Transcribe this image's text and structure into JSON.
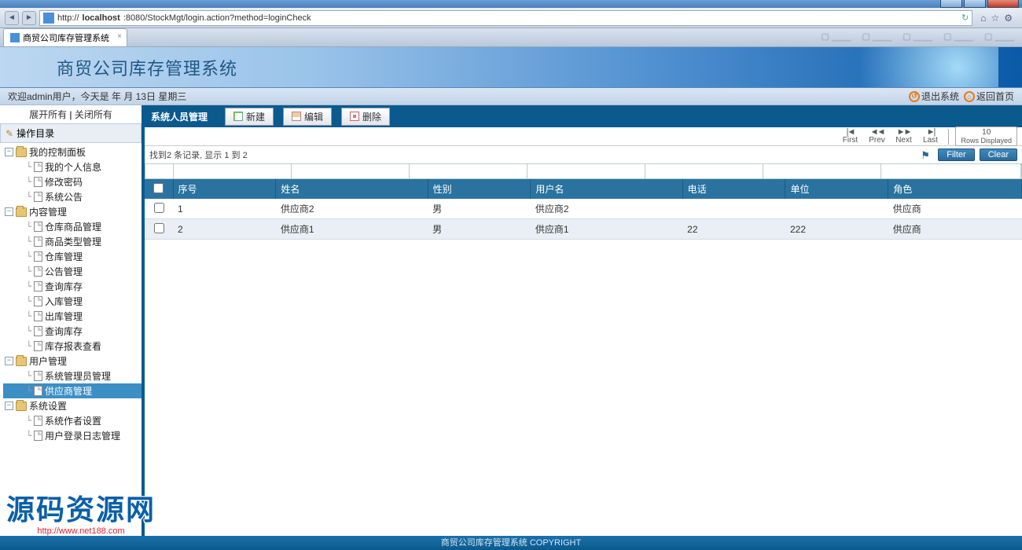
{
  "browser": {
    "url_prefix": "http://",
    "url_host": "localhost",
    "url_port_path": ":8080/StockMgt/login.action?method=loginCheck",
    "tab_title": "商贸公司库存管理系统"
  },
  "banner": {
    "title": "商贸公司库存管理系统"
  },
  "welcome": {
    "text": "欢迎admin用户，今天是 年 月 13日 星期三",
    "logout": "退出系统",
    "home": "返回首页"
  },
  "sidebar": {
    "expand_all": "展开所有",
    "collapse_all": "关闭所有",
    "ops": "操作目录",
    "nodes": [
      {
        "lvl": 1,
        "type": "folder",
        "open": true,
        "label": "我的控制面板"
      },
      {
        "lvl": 2,
        "type": "doc",
        "label": "我的个人信息"
      },
      {
        "lvl": 2,
        "type": "doc",
        "label": "修改密码"
      },
      {
        "lvl": 2,
        "type": "doc",
        "label": "系统公告"
      },
      {
        "lvl": 1,
        "type": "folder",
        "open": true,
        "label": "内容管理"
      },
      {
        "lvl": 2,
        "type": "doc",
        "label": "仓库商品管理"
      },
      {
        "lvl": 2,
        "type": "doc",
        "label": "商品类型管理"
      },
      {
        "lvl": 2,
        "type": "doc",
        "label": "仓库管理"
      },
      {
        "lvl": 2,
        "type": "doc",
        "label": "公告管理"
      },
      {
        "lvl": 2,
        "type": "doc",
        "label": "查询库存"
      },
      {
        "lvl": 2,
        "type": "doc",
        "label": "入库管理"
      },
      {
        "lvl": 2,
        "type": "doc",
        "label": "出库管理"
      },
      {
        "lvl": 2,
        "type": "doc",
        "label": "查询库存"
      },
      {
        "lvl": 2,
        "type": "doc",
        "label": "库存报表查看"
      },
      {
        "lvl": 1,
        "type": "folder",
        "open": true,
        "label": "用户管理"
      },
      {
        "lvl": 2,
        "type": "doc",
        "label": "系统管理员管理"
      },
      {
        "lvl": 2,
        "type": "doc",
        "label": "供应商管理",
        "selected": true
      },
      {
        "lvl": 1,
        "type": "folder",
        "open": true,
        "label": "系统设置"
      },
      {
        "lvl": 2,
        "type": "doc",
        "label": "系统作者设置"
      },
      {
        "lvl": 2,
        "type": "doc",
        "label": "用户登录日志管理"
      }
    ]
  },
  "panel": {
    "title": "系统人员管理",
    "btn_new": "新建",
    "btn_edit": "编辑",
    "btn_delete": "删除"
  },
  "pager": {
    "first": "First",
    "prev": "Prev",
    "next": "Next",
    "last": "Last",
    "rows_value": "10",
    "rows_label": "Rows Displayed"
  },
  "info": {
    "summary": "找到2 条记录, 显示 1 到 2",
    "filter": "Filter",
    "clear": "Clear"
  },
  "table": {
    "columns": [
      "",
      "序号",
      "姓名",
      "性别",
      "用户名",
      "电话",
      "单位",
      "角色"
    ],
    "rows": [
      {
        "no": "1",
        "name": "供应商2",
        "sex": "男",
        "user": "供应商2",
        "tel": "",
        "unit": "",
        "role": "供应商"
      },
      {
        "no": "2",
        "name": "供应商1",
        "sex": "男",
        "user": "供应商1",
        "tel": "22",
        "unit": "222",
        "role": "供应商"
      }
    ]
  },
  "footer": {
    "text": "商贸公司库存管理系统 COPYRIGHT"
  },
  "watermark": {
    "big": "源码资源网",
    "small": "http://www.net188.com"
  }
}
